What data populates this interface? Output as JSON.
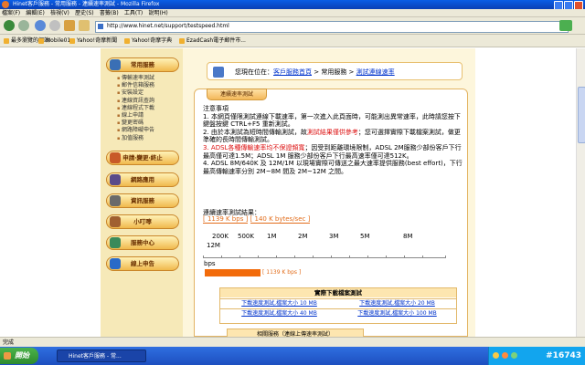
{
  "window": {
    "title": "Hinet客戶服務 - 常用服務 - 連續速率測試 - Mozilla Firefox"
  },
  "menu": [
    "檔案(F)",
    "編輯(E)",
    "檢視(V)",
    "歷史(S)",
    "書籤(B)",
    "工具(T)",
    "說明(H)"
  ],
  "address": {
    "url": "http://www.hinet.net/support/testspeed.html"
  },
  "bookmarks": [
    "最多瀏覽的網站",
    "Mobile01",
    "Yahoo!奇摩新聞",
    "Yahoo!奇摩字典",
    "EzadCash電子郵件市..."
  ],
  "sidebar": {
    "main_button": "常用服務",
    "items": [
      "傳輸速率測試",
      "郵件信箱服務",
      "安裝設定",
      "連線資訊查詢",
      "連線程式下載",
      "線上申請",
      "變更密碼",
      "網路障礙申告",
      "加值服務"
    ],
    "buttons": [
      "申請‧變更‧終止",
      "網路應用",
      "資訊服務",
      "小叮嚀",
      "服務中心",
      "線上申告"
    ]
  },
  "breadcrumb": {
    "prefix": "您現在位在：",
    "link1": "客戶服務首頁",
    "sep1": " > 常用服務 > ",
    "link2": "測試連線速率"
  },
  "panel": {
    "tab": "連續速率測試",
    "notes_title": "注意事項",
    "note1": "1. 本網頁僅限測試連線下載速率，第一次進入此頁面時，可能測出異常速率，此時請您按下鍵盤按鍵 CTRL+F5 重新測試。",
    "note2a": "2. 由於本測試為短時間傳輸測試，故",
    "note2red": "測試結果僅供參考",
    "note2b": "；您可選擇實際下載檔案測試，做更準確的長時間傳輸測試。",
    "note3red": "3. ADSL各種傳輸速率均不保證頻寬",
    "note3b": "；因受到距離環境限制，ADSL 2M服務少部份客戶下行最高僅可達1.5M；ADSL 1M 服務少部份客戶下行最高速率僅可達512K。",
    "note4": "4. ADSL 8M/640K 及 12M/1M 以現場實際可傳送之最大速率提供服務(best effort)，下行最高傳輸速率分別 2M~8M 間及 2M~12M 之間。",
    "result_title": "連續速率測試結果：",
    "result_kbps": "[ 1139 K bps ]",
    "result_kbytes": "[ 140 K bytes/sec ]",
    "ticks": [
      "200K",
      "500K",
      "1M",
      "2M",
      "3M",
      "5M",
      "8M",
      "12M"
    ],
    "bps_label": "bps",
    "bar_label": "[ 1139 K bps ]",
    "bar_fraction": 0.23,
    "download": {
      "title": "實際下載檔案測試",
      "links": [
        "下載速度測試,檔案大小 10 MB",
        "下載速度測試,檔案大小 20 MB",
        "下載速度測試,檔案大小 40 MB",
        "下載速度測試,檔案大小 100 MB"
      ]
    },
    "links_tab": "相關服務（連線上傳速率測試）"
  },
  "status": {
    "text": "完成"
  },
  "taskbar": {
    "start": "開始",
    "task": "Hinet客戶服務 - 常...",
    "watermark": "#16743"
  },
  "colors": {
    "accent": "#f26b0a",
    "panel_border": "#e3b463",
    "link": "#0033cc"
  }
}
